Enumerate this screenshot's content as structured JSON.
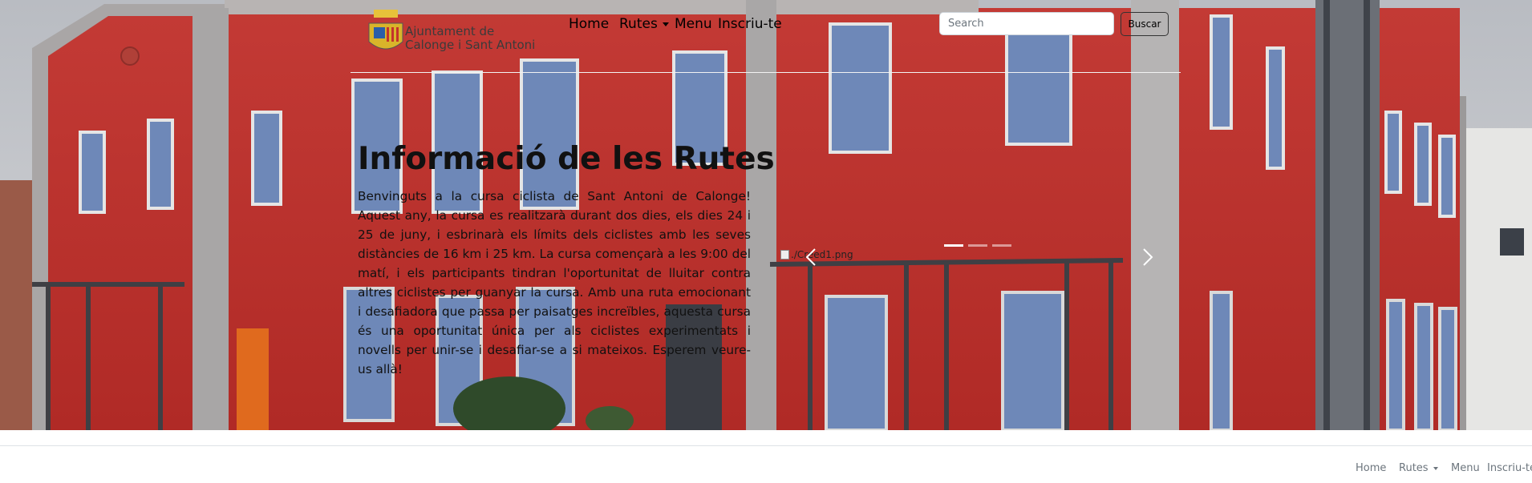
{
  "header": {
    "logo_line1": "Ajuntament de",
    "logo_line2": "Calonge i Sant Antoni",
    "nav": {
      "home": "Home",
      "rutes": "Rutes",
      "menu": "Menu",
      "inscriu": "Inscriu-te"
    },
    "search": {
      "placeholder": "Search",
      "value": "",
      "button_label": "Buscar"
    }
  },
  "hero": {
    "title": "Informació de les Rutes",
    "body": "Benvinguts a la cursa ciclista de Sant Antoni de Calonge! Aquest any, la cursa es realitzarà durant dos dies, els dies 24 i 25 de juny, i esbrinarà els límits dels ciclistes amb les seves distàncies de 16 km i 25 km. La cursa començarà a les 9:00 del matí, i els participants tindran l'oportunitat de lluitar contra altres ciclistes per guanyar la cursa. Amb una ruta emocionant i desafiadora que passa per paisatges increïbles, aquesta cursa és una oportunitat única per als ciclistes experimentats i novells per unir-se i desafiar-se a si mateixos. Esperem veure-us allà!"
  },
  "carousel": {
    "image_alt": "./Creed1.png",
    "active_slide": 1,
    "slide_count": 3,
    "prev_icon": "chevron-left-icon",
    "next_icon": "chevron-right-icon"
  },
  "footer": {
    "nav": {
      "home": "Home",
      "rutes": "Rutes",
      "menu": "Menu",
      "inscriu": "Inscriu-te"
    }
  },
  "colors": {
    "facade_red": "#c8312e",
    "window_blue": "#6e88b8",
    "footer_text": "#6c757d"
  }
}
